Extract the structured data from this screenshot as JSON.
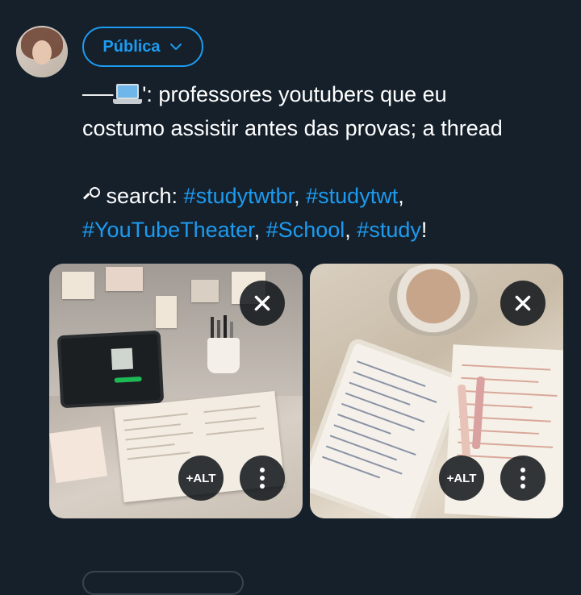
{
  "composer": {
    "avatar_icon": "user-avatar",
    "audience_label": "Pública",
    "audience_icon": "chevron-down-icon",
    "accent_color": "#1d9bf0",
    "background_color": "#15202b"
  },
  "tweet": {
    "line1_prefix": "──",
    "line1_emoji_icon": "laptop-emoji",
    "line1_text": "': professores youtubers que eu",
    "line2_text": "costumo assistir antes das provas; a thread",
    "search_icon": "search-icon",
    "search_label": " search: ",
    "hashtags": [
      "#studytwtbr",
      "#studytwt",
      "#YouTubeTheater",
      "#School",
      "#study"
    ],
    "sep": ", ",
    "end": "!"
  },
  "media": [
    {
      "remove_icon": "close-icon",
      "alt_label": "+ALT",
      "more_icon": "more-vertical-icon"
    },
    {
      "remove_icon": "close-icon",
      "alt_label": "+ALT",
      "more_icon": "more-vertical-icon"
    }
  ]
}
